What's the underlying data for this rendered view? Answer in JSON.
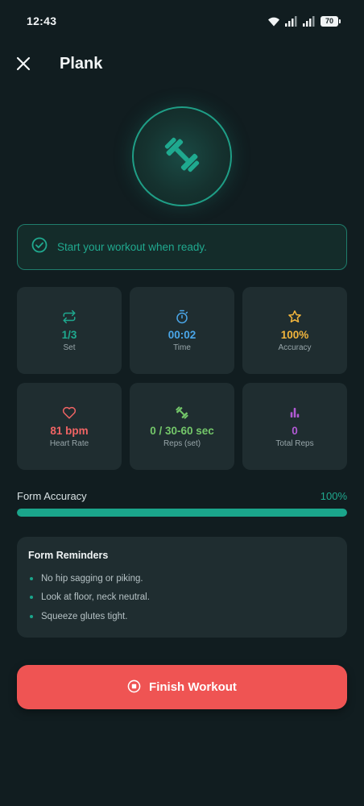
{
  "status_bar": {
    "time": "12:43",
    "battery": "70",
    "icons": [
      "wifi-icon",
      "signal-icon",
      "signal-icon",
      "battery-icon"
    ]
  },
  "header": {
    "title": "Plank",
    "close_icon": "close-icon"
  },
  "hero": {
    "icon": "dumbbell-icon",
    "accent_color": "#1f9e86"
  },
  "banner": {
    "text": "Start your workout when ready.",
    "icon": "check-circle-icon"
  },
  "stats": [
    {
      "icon": "repeat-icon",
      "value": "1/3",
      "label": "Set",
      "color": "#1fa98f"
    },
    {
      "icon": "stopwatch-icon",
      "value": "00:02",
      "label": "Time",
      "color": "#4aa6e8"
    },
    {
      "icon": "star-icon",
      "value": "100%",
      "label": "Accuracy",
      "color": "#f2b53c"
    },
    {
      "icon": "heart-icon",
      "value": "81 bpm",
      "label": "Heart Rate",
      "color": "#f06464"
    },
    {
      "icon": "dumbbell-icon",
      "value": "0 / 30-60 sec",
      "label": "Reps (set)",
      "color": "#74c76a"
    },
    {
      "icon": "bar-chart-icon",
      "value": "0",
      "label": "Total Reps",
      "color": "#b15ad4"
    }
  ],
  "form_accuracy": {
    "label": "Form Accuracy",
    "value": "100%",
    "progress_percent": 100
  },
  "reminders": {
    "title": "Form Reminders",
    "items": [
      "No hip sagging or piking.",
      "Look at floor, neck neutral.",
      "Squeeze glutes tight."
    ]
  },
  "finish_button": {
    "label": "Finish Workout",
    "icon": "stop-circle-icon",
    "color": "#ef5453"
  }
}
